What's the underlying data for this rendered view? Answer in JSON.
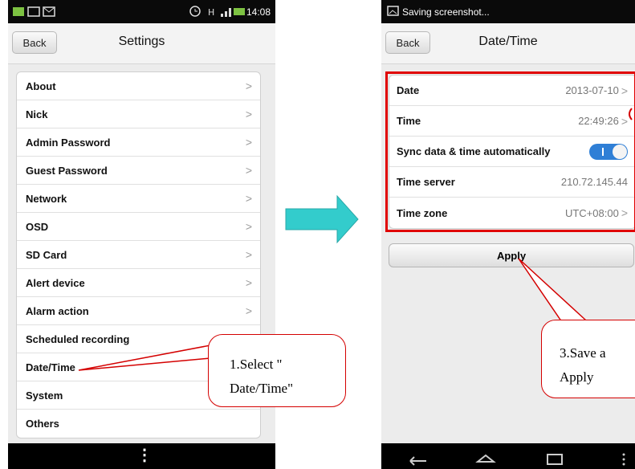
{
  "left_phone": {
    "status": {
      "time": "14:08"
    },
    "header": {
      "back_label": "Back",
      "title": "Settings"
    },
    "items": [
      {
        "label": "About"
      },
      {
        "label": "Nick"
      },
      {
        "label": "Admin Password"
      },
      {
        "label": "Guest Password"
      },
      {
        "label": "Network"
      },
      {
        "label": "OSD"
      },
      {
        "label": "SD Card"
      },
      {
        "label": "Alert device"
      },
      {
        "label": "Alarm action"
      },
      {
        "label": "Scheduled recording"
      },
      {
        "label": "Date/Time"
      },
      {
        "label": "System"
      },
      {
        "label": "Others"
      }
    ],
    "chevron": ">",
    "menu_glyph": "⋮"
  },
  "right_phone": {
    "status": {
      "text": "Saving screenshot..."
    },
    "header": {
      "back_label": "Back",
      "title": "Date/Time"
    },
    "rows": {
      "date": {
        "label": "Date",
        "value": "2013-07-10"
      },
      "time": {
        "label": "Time",
        "value": "22:49:26"
      },
      "sync": {
        "label": "Sync data & time automatically",
        "on": true
      },
      "server": {
        "label": "Time server",
        "value": "210.72.145.44"
      },
      "zone": {
        "label": "Time zone",
        "value": "UTC+08:00"
      }
    },
    "apply_label": "Apply"
  },
  "annotations": {
    "callout1_line1": "1.Select \"",
    "callout1_line2": "Date/Time\"",
    "callout2_line1": "3.Save a",
    "callout2_line2": "Apply"
  },
  "colors": {
    "arrow": "#33cccc",
    "callout_border": "#d40000",
    "toggle_on": "#2f7fd6"
  }
}
